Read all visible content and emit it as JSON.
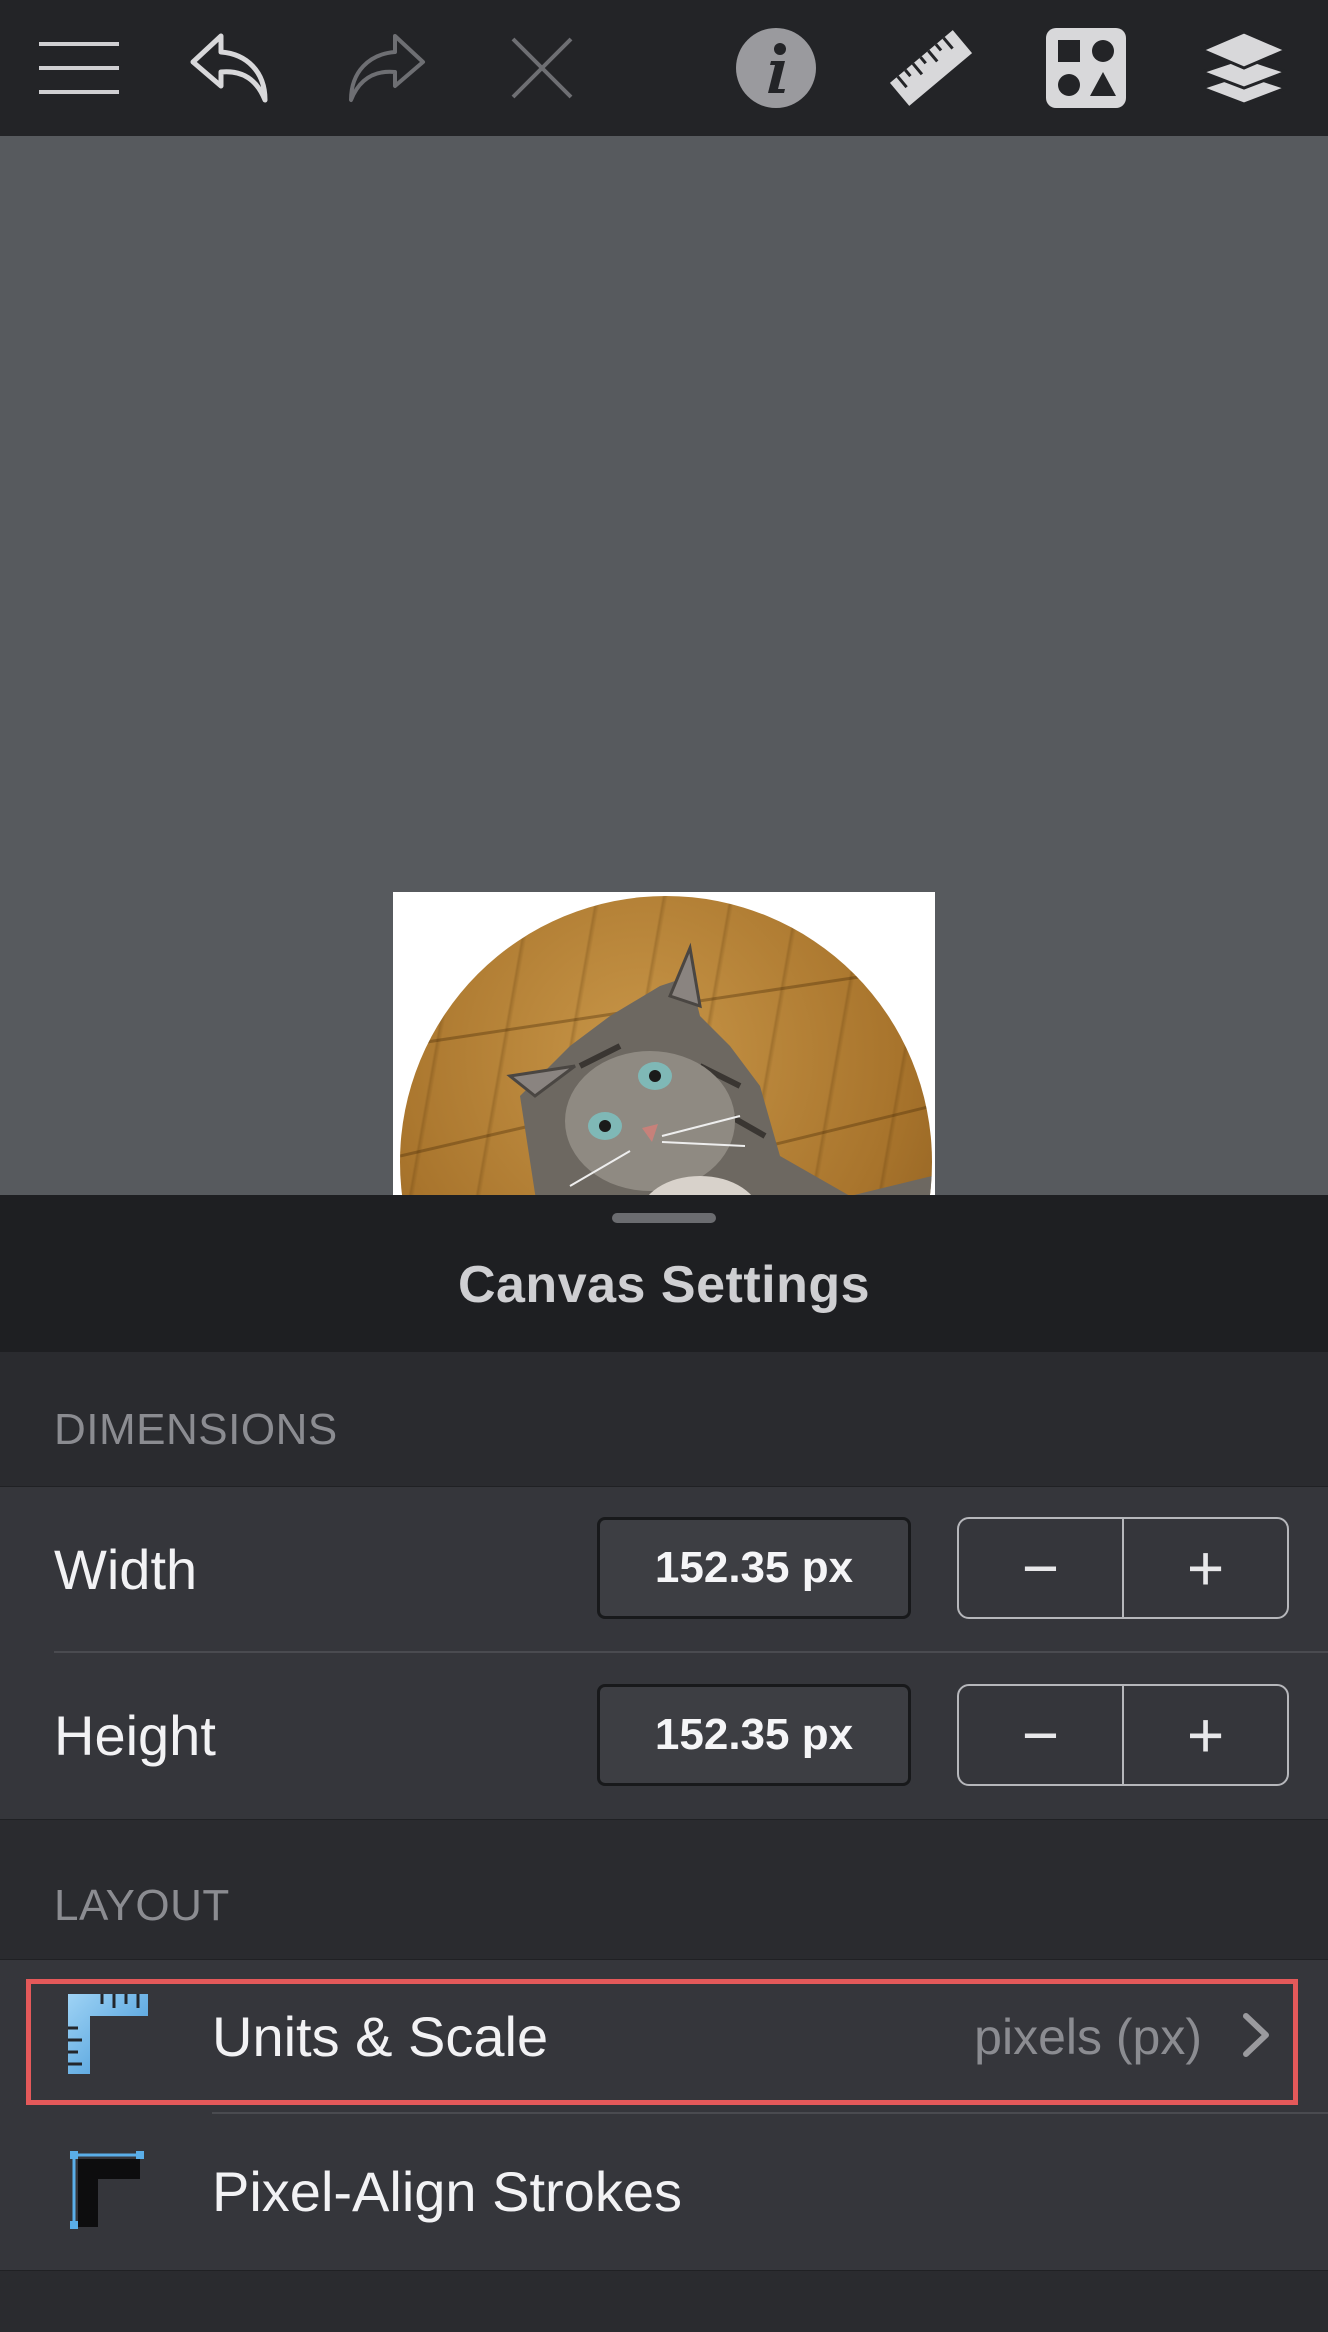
{
  "toolbar": {
    "buttons": [
      {
        "name": "menu-icon",
        "enabled": true
      },
      {
        "name": "undo-icon",
        "enabled": true
      },
      {
        "name": "redo-icon",
        "enabled": false
      },
      {
        "name": "close-icon",
        "enabled": false
      },
      {
        "name": "info-icon",
        "enabled": true
      },
      {
        "name": "ruler-icon",
        "enabled": true
      },
      {
        "name": "shapes-library-icon",
        "enabled": true
      },
      {
        "name": "layers-icon",
        "enabled": true
      }
    ]
  },
  "canvas": {
    "background_color": "#575a5e",
    "artboard_image": "cat-photo-circle"
  },
  "sheet": {
    "title": "Canvas Settings",
    "dimensions": {
      "section_label": "DIMENSIONS",
      "width": {
        "label": "Width",
        "value": "152.35 px",
        "minus": "−",
        "plus": "+"
      },
      "height": {
        "label": "Height",
        "value": "152.35 px",
        "minus": "−",
        "plus": "+"
      }
    },
    "layout": {
      "section_label": "LAYOUT",
      "units_scale": {
        "label": "Units & Scale",
        "value": "pixels (px)",
        "icon": "ruler-corner-icon",
        "chevron": "chevron-right-icon"
      },
      "pixel_align": {
        "label": "Pixel-Align Strokes",
        "icon": "pixel-align-icon"
      }
    }
  },
  "colors": {
    "toolbar_bg": "#232427",
    "sheet_bg": "#2a2b2f",
    "row_bg": "#35363b",
    "highlight": "#e4595a",
    "accent_blue": "#5aaee8"
  }
}
